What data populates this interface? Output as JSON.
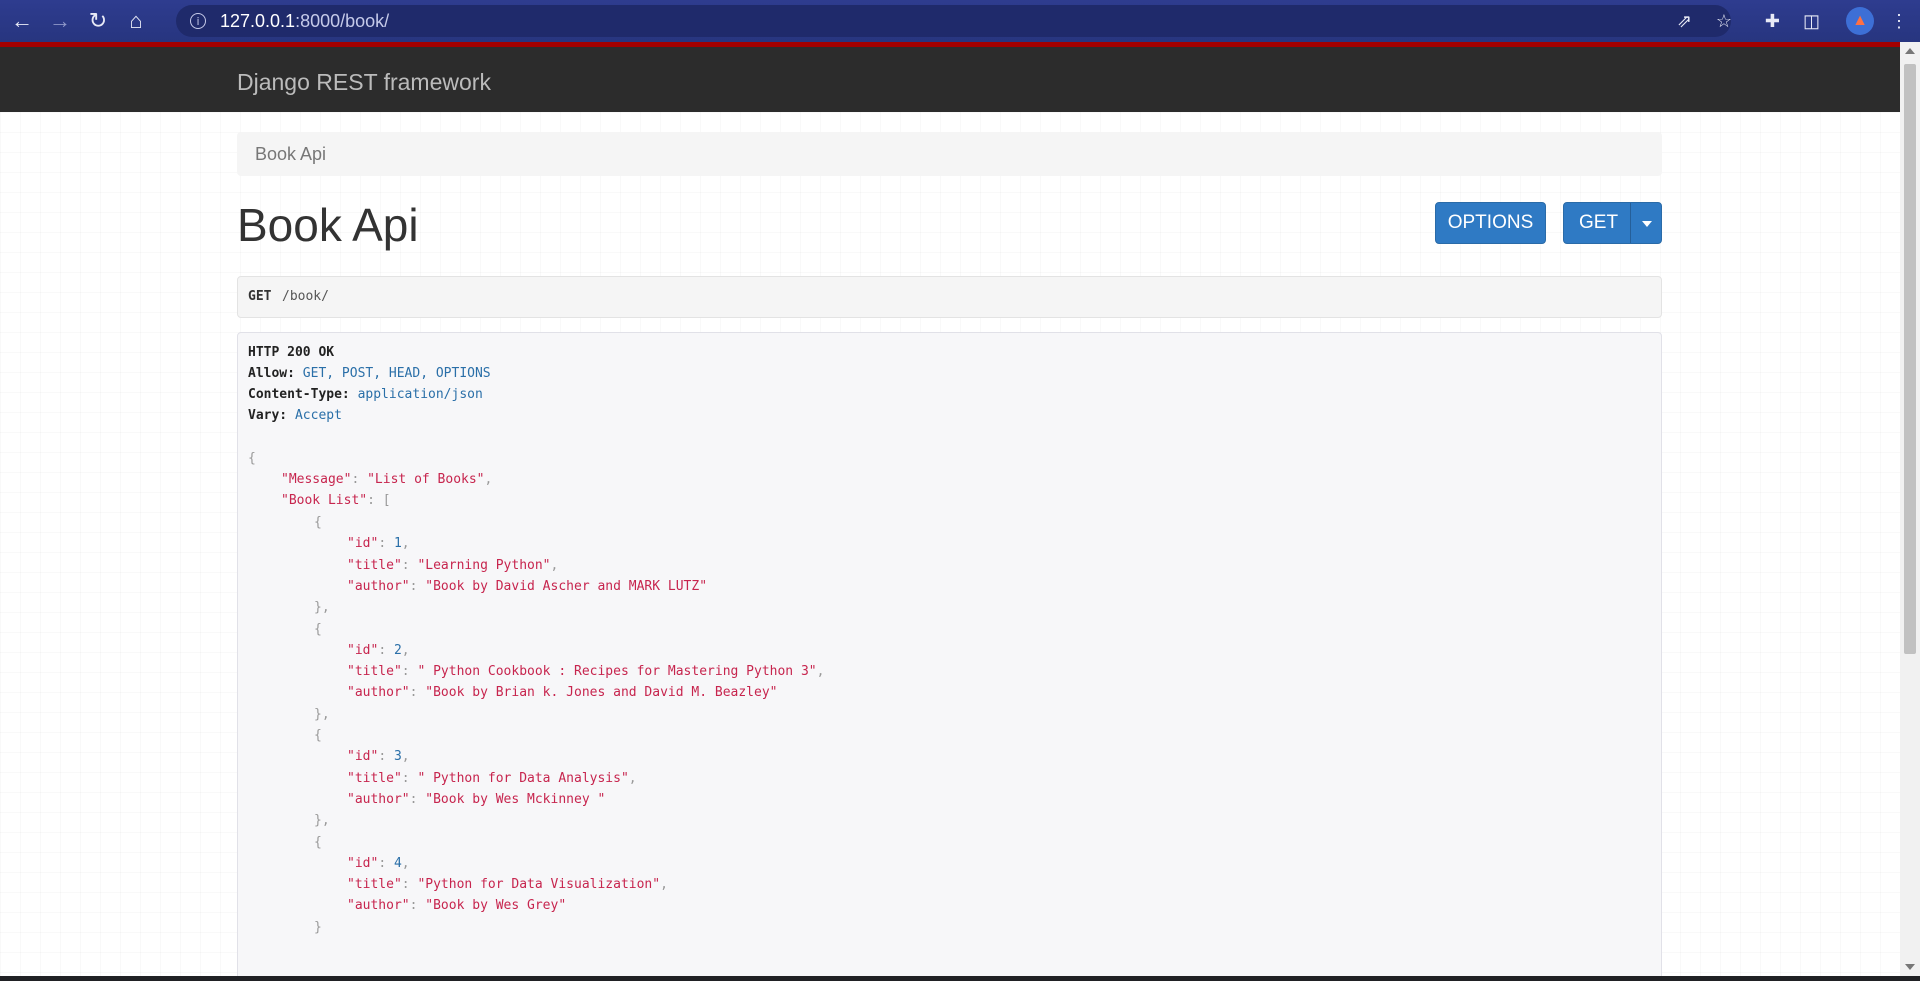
{
  "browser": {
    "url_host": "127.0.0.1",
    "url_rest": ":8000/book/",
    "icons": [
      "back-icon",
      "forward-icon",
      "reload-icon",
      "home-icon",
      "site-info-icon",
      "share-icon",
      "bookmark-star-icon",
      "extensions-icon",
      "side-panel-icon",
      "profile-icon",
      "menu-icon"
    ]
  },
  "navbar": {
    "brand": "Django REST framework"
  },
  "breadcrumb": {
    "label": "Book Api"
  },
  "page": {
    "title": "Book Api",
    "options_label": "OPTIONS",
    "get_label": "GET"
  },
  "request": {
    "method": "GET",
    "path": "/book/"
  },
  "response": {
    "status": "HTTP 200 OK",
    "headers": [
      {
        "key": "Allow:",
        "value": "GET, POST, HEAD, OPTIONS"
      },
      {
        "key": "Content-Type:",
        "value": "application/json"
      },
      {
        "key": "Vary:",
        "value": "Accept"
      }
    ],
    "message_key": "\"Message\"",
    "message_value": "\"List of Books\"",
    "list_key": "\"Book List\"",
    "books": [
      {
        "id": "1",
        "title": "\"Learning Python\"",
        "author": "\"Book by David Ascher and MARK LUTZ\""
      },
      {
        "id": "2",
        "title": "\" Python Cookbook : Recipes for Mastering Python 3\"",
        "author": "\"Book by Brian k. Jones and David M. Beazley\""
      },
      {
        "id": "3",
        "title": "\" Python for Data Analysis\"",
        "author": "\"Book by Wes Mckinney \""
      },
      {
        "id": "4",
        "title": "\"Python for Data Visualization\"",
        "author": "\"Book by Wes Grey\""
      }
    ]
  }
}
